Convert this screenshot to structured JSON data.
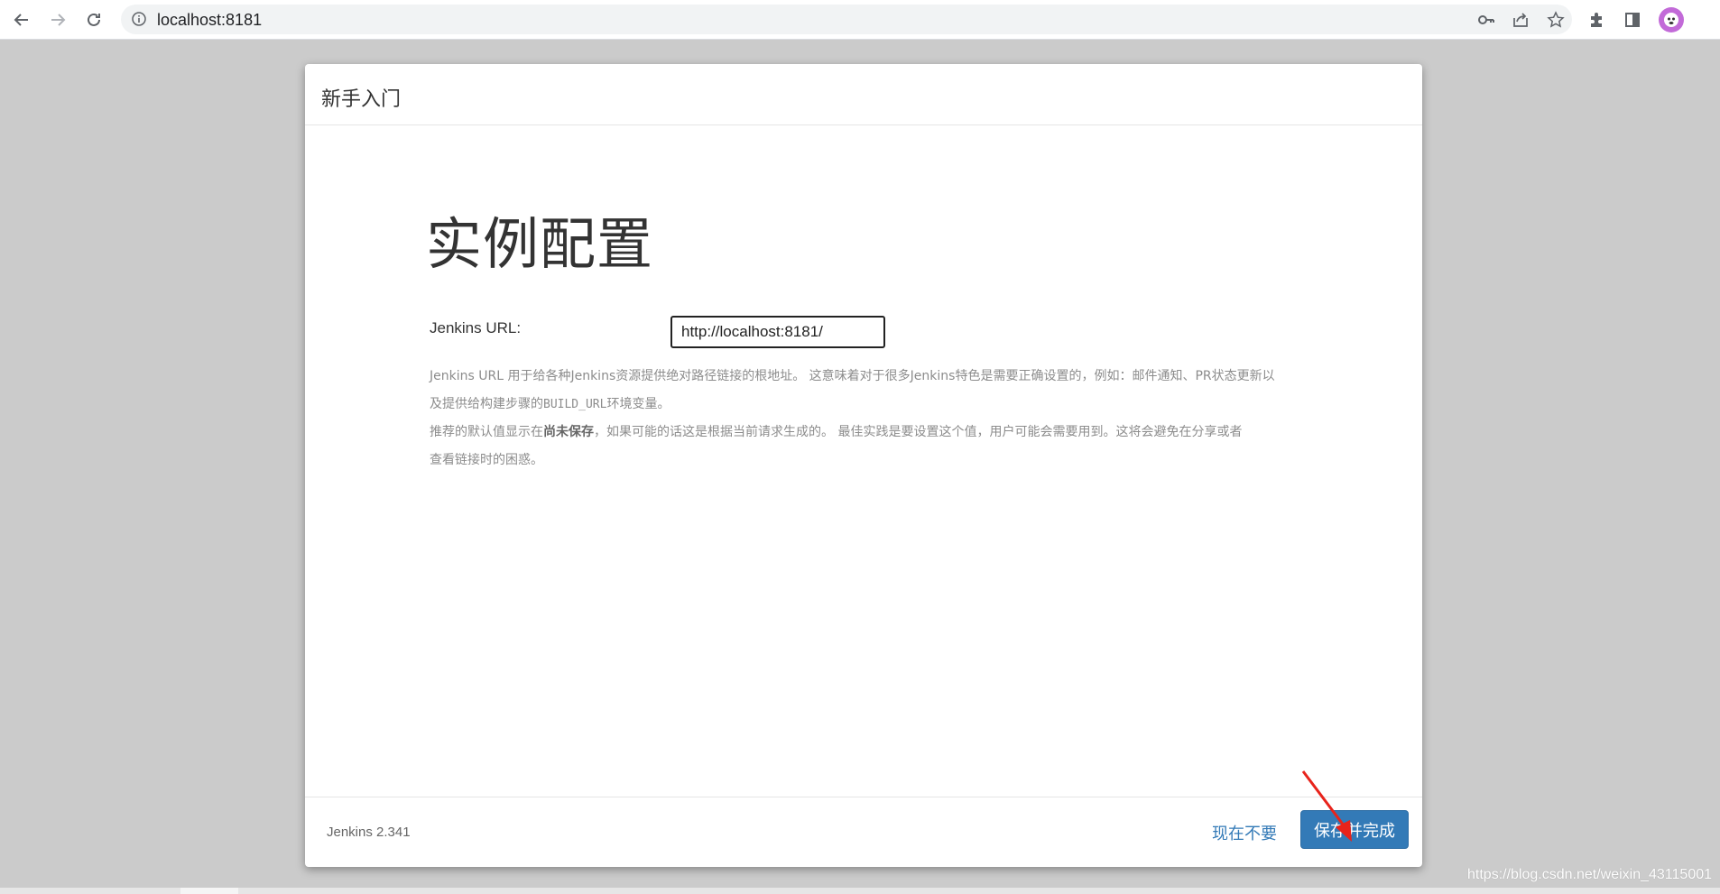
{
  "browser": {
    "url": "localhost:8181",
    "icons": {
      "back": "back-arrow-icon",
      "forward": "forward-arrow-icon",
      "reload": "reload-icon",
      "info": "info-icon",
      "key": "key-icon",
      "share": "share-icon",
      "star": "star-icon",
      "extensions": "puzzle-icon",
      "sidepanel": "side-panel-icon",
      "profile": "avatar"
    }
  },
  "dialog": {
    "title": "新手入门",
    "heading": "实例配置",
    "url_label": "Jenkins URL:",
    "url_value": "http://localhost:8181/",
    "help": {
      "line1": "Jenkins URL 用于给各种Jenkins资源提供绝对路径链接的根地址。 这意味着对于很多Jenkins特色是需要正确设置的，例如：邮件通知、PR状态更新以",
      "line2a": "及提供给构建步骤的",
      "line2_code": "BUILD_URL",
      "line2b": "环境变量。",
      "line3a": "推荐的默认值显示在",
      "line3_bold": "尚未保存",
      "line3b": "，如果可能的话这是根据当前请求生成的。 最佳实践是要设置这个值，用户可能会需要用到。这将会避免在分享或者",
      "line4": "查看链接时的困惑。"
    },
    "version": "Jenkins 2.341",
    "skip_label": "现在不要",
    "save_label": "保存并完成"
  },
  "watermark": "https://blog.csdn.net/weixin_43115001",
  "colors": {
    "primary": "#337ab7",
    "arrow": "#e8231b",
    "backdrop": "#cbcbcb"
  }
}
